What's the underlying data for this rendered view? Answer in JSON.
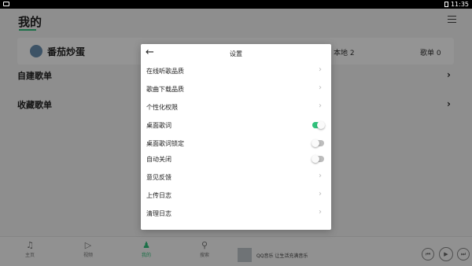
{
  "status_bar": {
    "time": "11:35"
  },
  "page": {
    "title": "我的"
  },
  "profile": {
    "name": "番茄炒蛋",
    "local_label": "本地",
    "local_count": "2",
    "playlist_label": "歌单",
    "playlist_count": "0"
  },
  "sections": {
    "created": "自建歌单",
    "collected": "收藏歌单"
  },
  "bottom_nav": {
    "tabs": [
      {
        "label": "主页",
        "icon": "music-note-icon"
      },
      {
        "label": "视频",
        "icon": "play-video-icon"
      },
      {
        "label": "我的",
        "icon": "person-icon"
      },
      {
        "label": "搜索",
        "icon": "search-icon"
      }
    ],
    "now_playing": "QQ音乐 让生活充满音乐"
  },
  "settings_dialog": {
    "title": "设置",
    "items": [
      {
        "label": "在线听歌品质",
        "type": "arrow"
      },
      {
        "label": "歌曲下载品质",
        "type": "arrow"
      },
      {
        "label": "个性化权限",
        "type": "arrow"
      },
      {
        "label": "桌面歌词",
        "type": "toggle",
        "on": true
      },
      {
        "label": "桌面歌词锁定",
        "type": "toggle",
        "on": false
      },
      {
        "label": "自动关闭",
        "type": "toggle",
        "on": false
      },
      {
        "label": "意见反馈",
        "type": "arrow"
      },
      {
        "label": "上传日志",
        "type": "arrow"
      },
      {
        "label": "清理日志",
        "type": "arrow"
      }
    ]
  },
  "colors": {
    "accent": "#31c27c"
  }
}
